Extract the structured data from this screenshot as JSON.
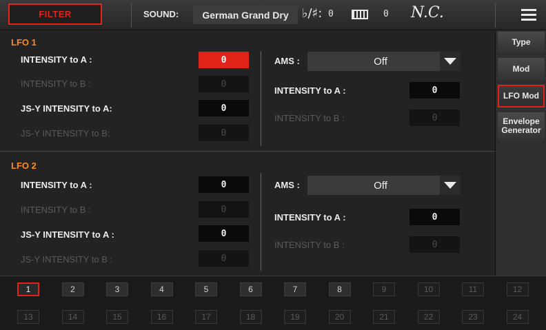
{
  "header": {
    "filter_label": "FILTER",
    "sound_label": "SOUND:",
    "sound_name": "German Grand Dry",
    "transpose_symbol": "♭/♯:",
    "transpose_value": "0",
    "octave_value": "0",
    "chord": "N.C.",
    "menu_icon": "hamburger-menu-icon",
    "keyboard_icon": "keyboard-icon"
  },
  "lfo1": {
    "title": "LFO 1",
    "left": [
      {
        "label": "INTENSITY to A :",
        "value": "0",
        "enabled": true,
        "selected": true
      },
      {
        "label": "INTENSITY to B :",
        "value": "0",
        "enabled": false
      },
      {
        "label": "JS-Y INTENSITY to A:",
        "value": "0",
        "enabled": true
      },
      {
        "label": "JS-Y INTENSITY to B:",
        "value": "0",
        "enabled": false
      }
    ],
    "ams_label": "AMS :",
    "ams_value": "Off",
    "right": [
      {
        "label": "INTENSITY to A :",
        "value": "0",
        "enabled": true
      },
      {
        "label": "INTENSITY to B :",
        "value": "0",
        "enabled": false
      }
    ]
  },
  "lfo2": {
    "title": "LFO 2",
    "left": [
      {
        "label": "INTENSITY to A :",
        "value": "0",
        "enabled": true
      },
      {
        "label": "INTENSITY to B :",
        "value": "0",
        "enabled": false
      },
      {
        "label": "JS-Y INTENSITY to A :",
        "value": "0",
        "enabled": true
      },
      {
        "label": "JS-Y INTENSITY to B :",
        "value": "0",
        "enabled": false
      }
    ],
    "ams_label": "AMS :",
    "ams_value": "Off",
    "right": [
      {
        "label": "INTENSITY to A :",
        "value": "0",
        "enabled": true
      },
      {
        "label": "INTENSITY to B :",
        "value": "0",
        "enabled": false
      }
    ]
  },
  "tabs": [
    {
      "label": "Type",
      "active": false
    },
    {
      "label": "Mod",
      "active": false
    },
    {
      "label": "LFO Mod",
      "active": true
    },
    {
      "label": "Envelope Generator",
      "active": false
    }
  ],
  "slots": [
    "1",
    "2",
    "3",
    "4",
    "5",
    "6",
    "7",
    "8",
    "9",
    "10",
    "11",
    "12",
    "13",
    "14",
    "15",
    "16",
    "17",
    "18",
    "19",
    "20",
    "21",
    "22",
    "23",
    "24"
  ],
  "active_slot": "1",
  "enabled_slots": [
    "1",
    "2",
    "3",
    "4",
    "5",
    "6",
    "7",
    "8"
  ],
  "colors": {
    "accent": "#e2231a",
    "section_title": "#ff8a1a"
  }
}
